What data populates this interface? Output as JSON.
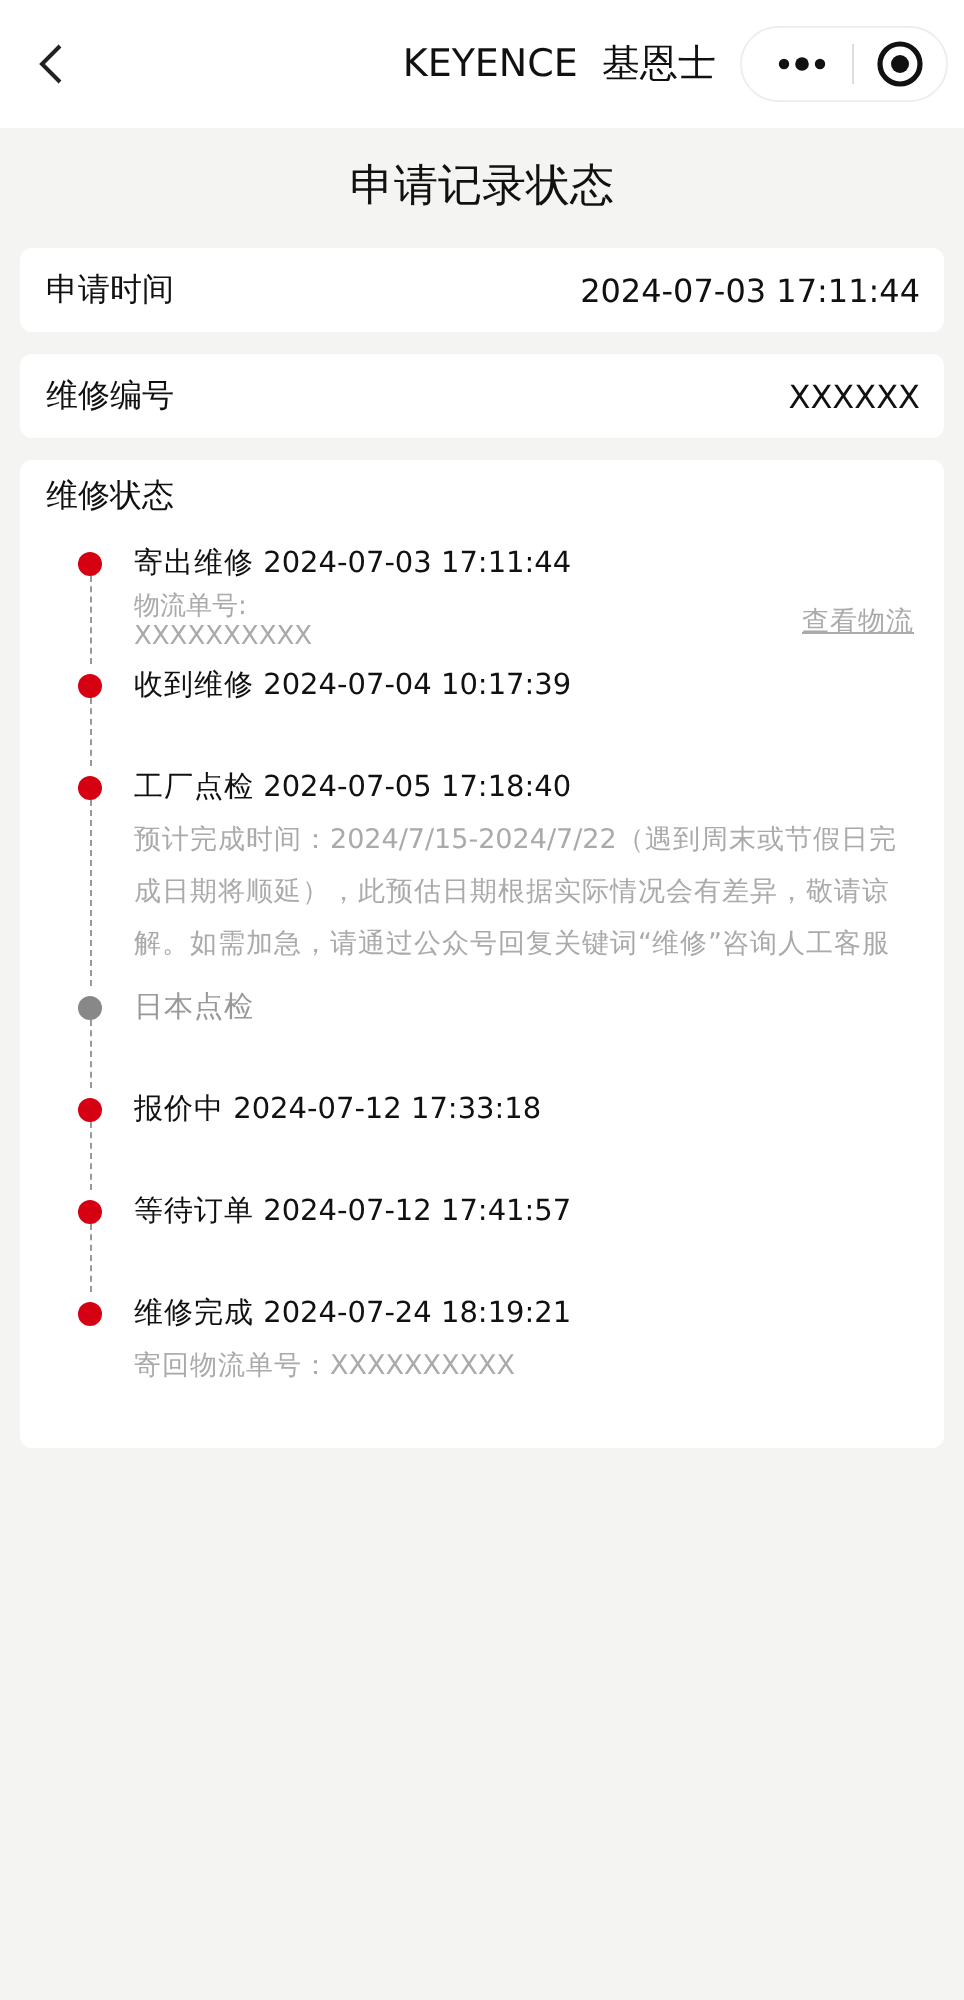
{
  "nav_bar": {
    "title": "KEYENCE  基恩士"
  },
  "page_title": "申请记录状态",
  "info_rows": [
    {
      "label": "申请时间",
      "value": "2024-07-03 17:11:44"
    },
    {
      "label": "维修编号",
      "value": "XXXXXX"
    }
  ],
  "status_card": {
    "title": "维修状态",
    "steps": [
      {
        "title": "寄出维修 2024-07-03 17:11:44",
        "done": true,
        "kind": "tracking",
        "tracking_label": "物流单号:",
        "tracking_number": "XXXXXXXXXX",
        "link": "查看物流"
      },
      {
        "title": "收到维修 2024-07-04 10:17:39",
        "done": true,
        "kind": "plain"
      },
      {
        "title": "工厂点检 2024-07-05 17:18:40",
        "done": true,
        "kind": "note",
        "note": "预计完成时间：2024/7/15-2024/7/22（遇到周末或节假日完成日期将顺延），此预估日期根据实际情况会有差异，敬请谅解。如需加急，请通过公众号回复关键词“维修”咨询人工客服"
      },
      {
        "title": "日本点检",
        "done": false,
        "kind": "plain"
      },
      {
        "title": "报价中 2024-07-12 17:33:18",
        "done": true,
        "kind": "plain"
      },
      {
        "title": "等待订单 2024-07-12 17:41:57",
        "done": true,
        "kind": "plain"
      },
      {
        "title": "维修完成 2024-07-24 18:19:21",
        "done": true,
        "kind": "note",
        "note": "寄回物流单号：XXXXXXXXXX"
      }
    ]
  }
}
